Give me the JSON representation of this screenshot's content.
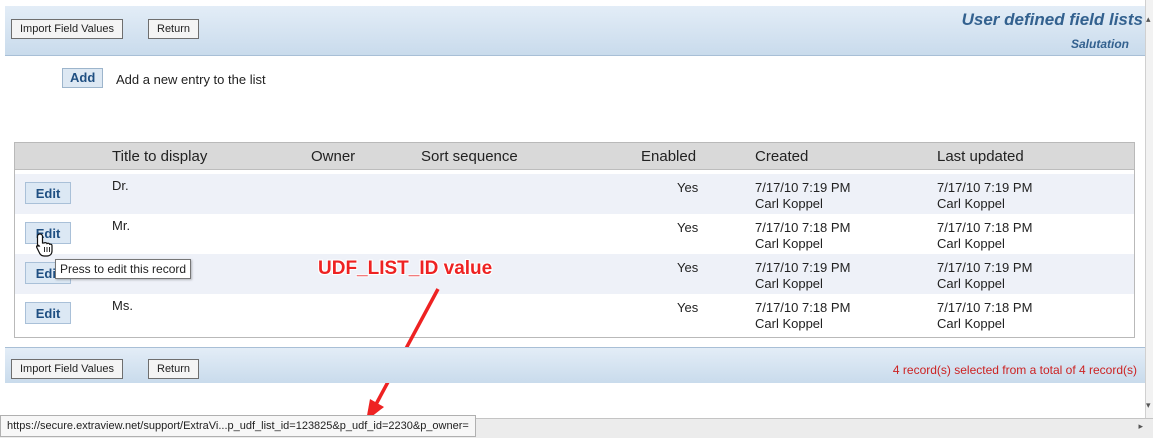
{
  "toolbar": {
    "import_label": "Import Field Values",
    "return_label": "Return"
  },
  "header": {
    "title": "User defined field lists",
    "subtitle": "Salutation"
  },
  "add": {
    "button_label": "Add",
    "description": "Add a new entry to the list"
  },
  "table": {
    "columns": [
      "Title to display",
      "Owner",
      "Sort sequence",
      "Enabled",
      "Created",
      "Last updated"
    ],
    "edit_label": "Edit",
    "rows": [
      {
        "title": "Dr.",
        "owner": "",
        "sort": "",
        "enabled": "Yes",
        "created_date": "7/17/10 7:19 PM",
        "created_by": "Carl Koppel",
        "updated_date": "7/17/10 7:19 PM",
        "updated_by": "Carl Koppel"
      },
      {
        "title": "Mr.",
        "owner": "",
        "sort": "",
        "enabled": "Yes",
        "created_date": "7/17/10 7:18 PM",
        "created_by": "Carl Koppel",
        "updated_date": "7/17/10 7:18 PM",
        "updated_by": "Carl Koppel"
      },
      {
        "title": "",
        "owner": "",
        "sort": "",
        "enabled": "Yes",
        "created_date": "7/17/10 7:19 PM",
        "created_by": "Carl Koppel",
        "updated_date": "7/17/10 7:19 PM",
        "updated_by": "Carl Koppel"
      },
      {
        "title": "Ms.",
        "owner": "",
        "sort": "",
        "enabled": "Yes",
        "created_date": "7/17/10 7:18 PM",
        "created_by": "Carl Koppel",
        "updated_date": "7/17/10 7:18 PM",
        "updated_by": "Carl Koppel"
      }
    ]
  },
  "tooltip": "Press to edit this record",
  "annotation": "UDF_LIST_ID value",
  "footer": {
    "record_count": "4 record(s) selected from a total of 4 record(s)"
  },
  "status_bar": {
    "url": "https://secure.extraview.net/support/ExtraVi...p_udf_list_id=123825&p_udf_id=2230&p_owner="
  },
  "icons": {
    "hand_cursor": "hand-pointer-icon",
    "annotation_arrow": "red-arrow-icon"
  },
  "colors": {
    "accent": "#33618f",
    "annotation": "#ee2222",
    "record_count": "#cc2222"
  }
}
